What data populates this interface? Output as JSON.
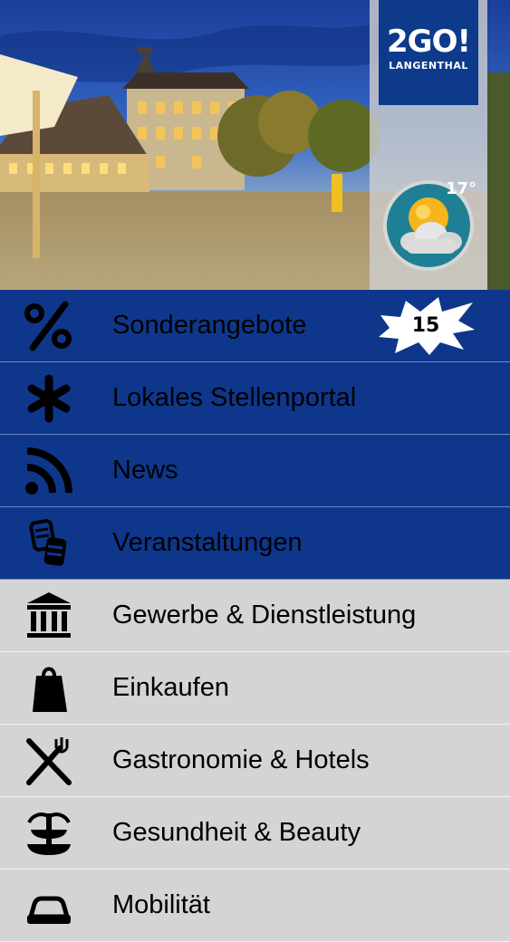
{
  "header": {
    "logo_main": "2GO!",
    "logo_sub": "LANGENTHAL",
    "weather": {
      "temperature": "17°",
      "icon": "partly-cloudy-icon"
    }
  },
  "menu": {
    "items": [
      {
        "label": "Sonderangebote",
        "icon": "percent-icon",
        "badge": "15"
      },
      {
        "label": "Lokales Stellenportal",
        "icon": "asterisk-icon"
      },
      {
        "label": "News",
        "icon": "rss-icon"
      },
      {
        "label": "Veranstaltungen",
        "icon": "tickets-icon"
      },
      {
        "label": "Gewerbe & Dienstleistung",
        "icon": "bank-icon"
      },
      {
        "label": "Einkaufen",
        "icon": "shopping-bag-icon"
      },
      {
        "label": "Gastronomie & Hotels",
        "icon": "fork-knife-icon"
      },
      {
        "label": "Gesundheit & Beauty",
        "icon": "fountain-icon"
      },
      {
        "label": "Mobilität",
        "icon": "car-icon"
      }
    ]
  },
  "colors": {
    "primary_blue": "#0e378c",
    "menu_gray": "#d4d4d4",
    "logo_blue": "#0e3a8c"
  }
}
